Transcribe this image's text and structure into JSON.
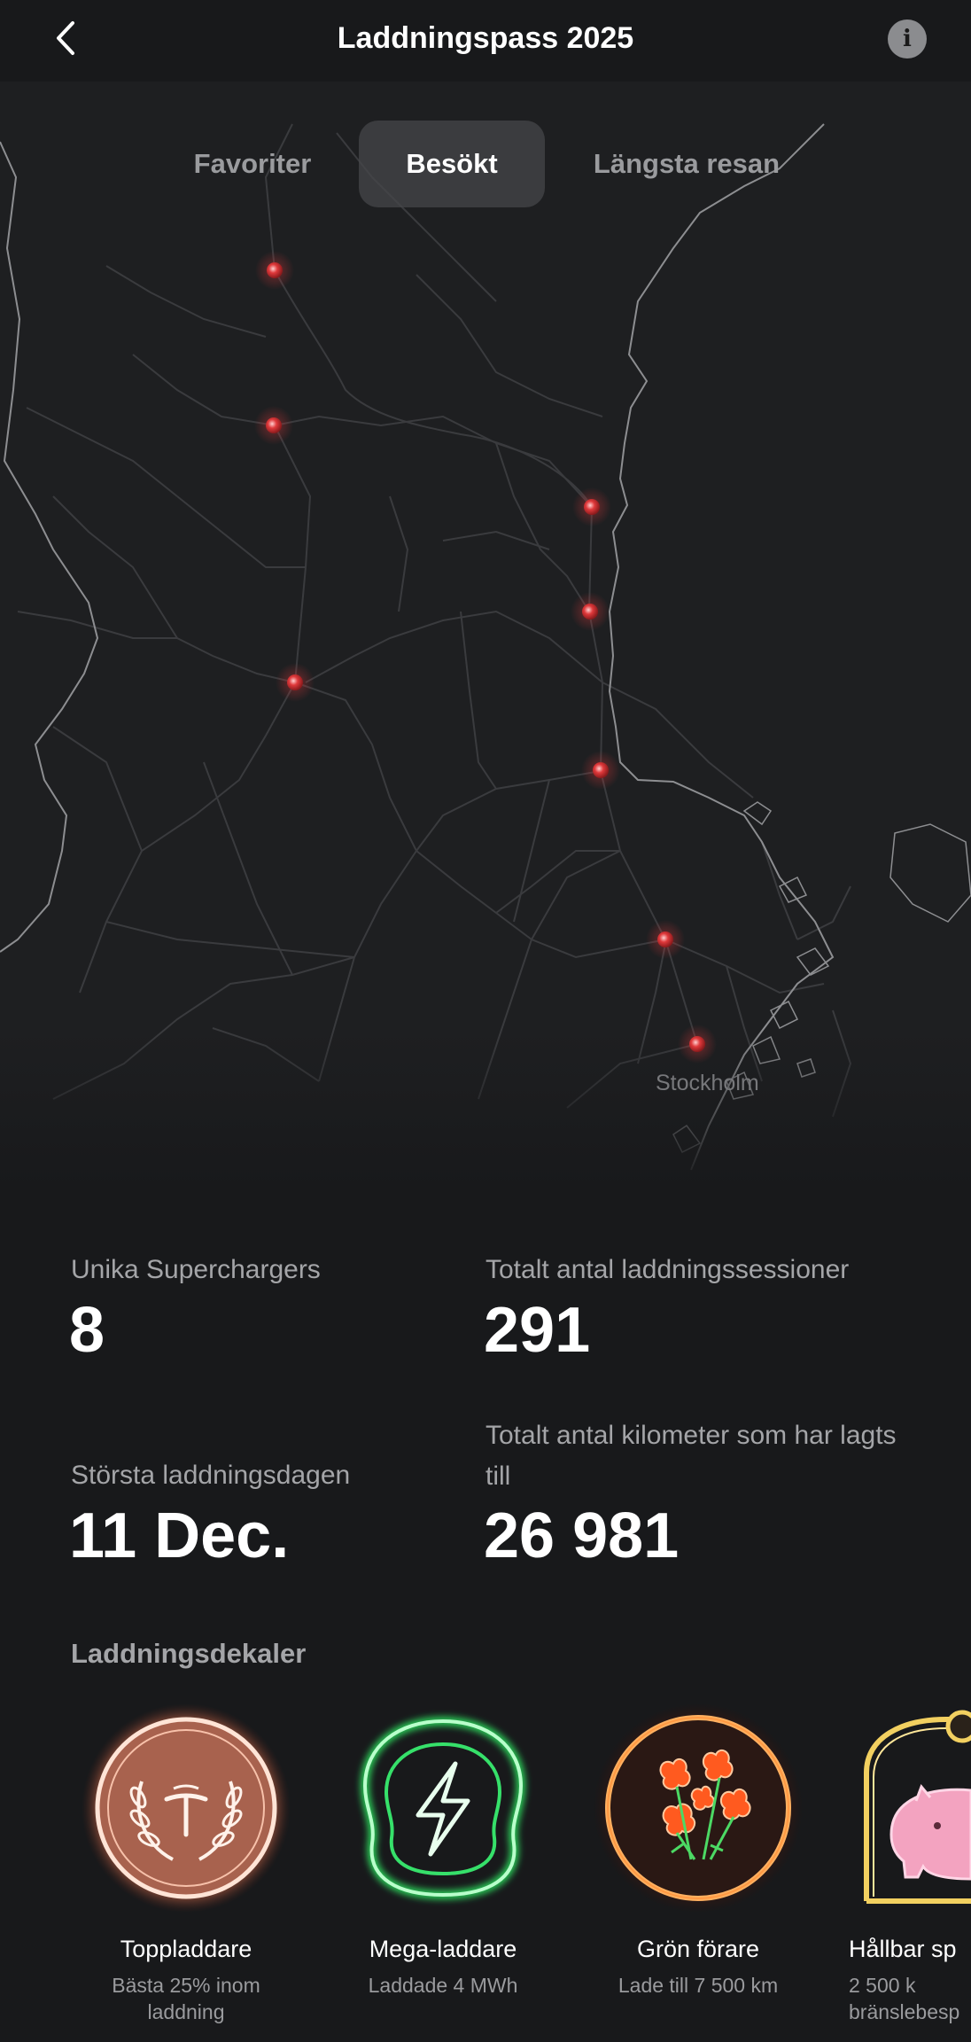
{
  "header": {
    "title": "Laddningspass 2025"
  },
  "tabs": [
    {
      "label": "Favoriter"
    },
    {
      "label": "Besökt"
    },
    {
      "label": "Längsta resan"
    }
  ],
  "map": {
    "city_label": "Stockholm",
    "marker_color": "#e0393b"
  },
  "stats": {
    "unique_superchargers": {
      "label": "Unika Superchargers",
      "value": "8"
    },
    "total_sessions": {
      "label": "Totalt antal laddningssessioner",
      "value": "291"
    },
    "biggest_day": {
      "label": "Största laddningsdagen",
      "value": "11 Dec."
    },
    "total_km": {
      "label": "Totalt antal kilometer som har lagts till",
      "value": "26 981"
    }
  },
  "stickers": {
    "title": "Laddningsdekaler",
    "items": [
      {
        "name": "Toppladdare",
        "desc": "Bästa 25% inom laddning",
        "color": "#f0a98a"
      },
      {
        "name": "Mega-laddare",
        "desc": "Laddade 4 MWh",
        "color": "#3ddc6a"
      },
      {
        "name": "Grön förare",
        "desc": "Lade till 7 500 km",
        "color": "#ff8a30"
      },
      {
        "name": "Hållbar sp",
        "desc": "2 500 k bränslebesp",
        "color": "#f3a3c0"
      }
    ]
  }
}
